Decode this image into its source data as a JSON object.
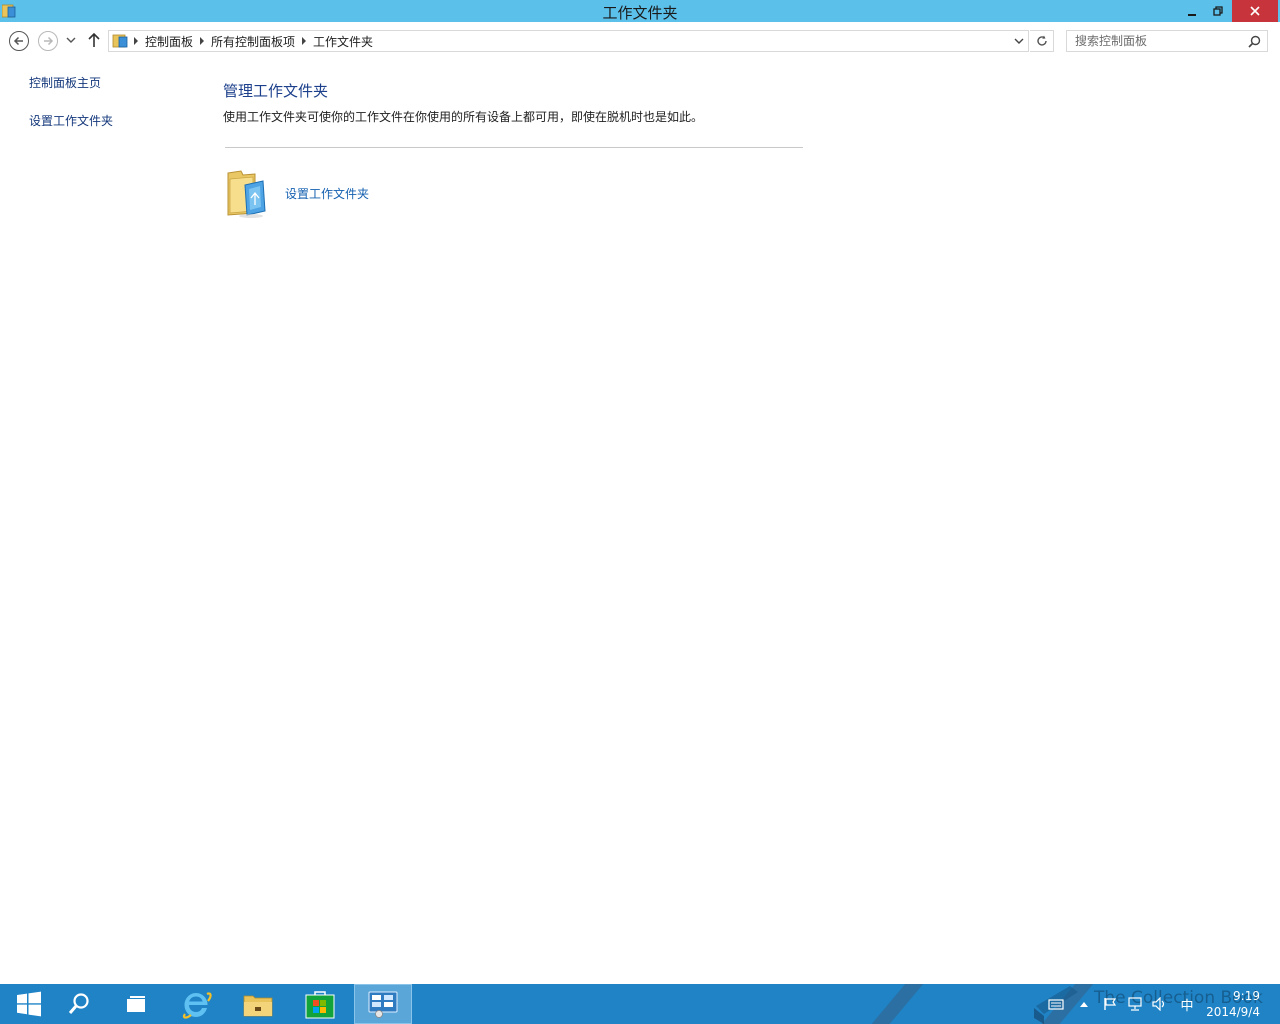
{
  "window": {
    "title": "工作文件夹"
  },
  "address_bar": {
    "breadcrumbs": [
      "控制面板",
      "所有控制面板项",
      "工作文件夹"
    ]
  },
  "search": {
    "placeholder": "搜索控制面板"
  },
  "left_pane": {
    "items": [
      {
        "label": "控制面板主页"
      },
      {
        "label": "设置工作文件夹"
      }
    ]
  },
  "main": {
    "heading": "管理工作文件夹",
    "description": "使用工作文件夹可使你的工作文件在你使用的所有设备上都可用，即使在脱机时也是如此。",
    "task_link": "设置工作文件夹"
  },
  "taskbar": {
    "items": [
      "start-icon",
      "search-icon",
      "task-view-icon",
      "internet-explorer-icon",
      "file-explorer-icon",
      "store-icon",
      "control-panel-icon"
    ],
    "active_item": "control-panel-icon",
    "watermark": "The Collection Book",
    "tray_ime": "中",
    "clock_time": "9:19",
    "clock_date": "2014/9/4"
  },
  "colors": {
    "titlebar": "#5bc0ea",
    "close_button": "#c7343b",
    "taskbar": "#1f83c6",
    "link": "#1460b0",
    "heading": "#1b3f8b"
  }
}
